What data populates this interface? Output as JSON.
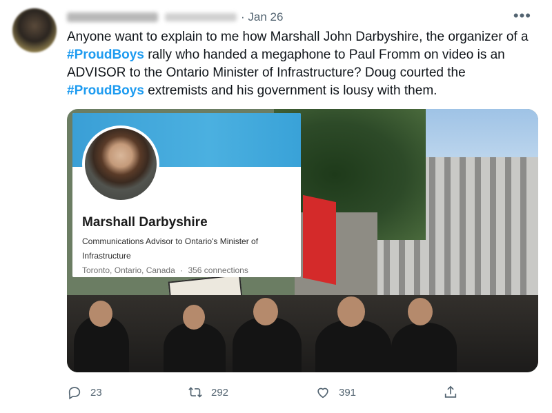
{
  "tweet": {
    "date": "Jan 26",
    "more_label": "•••",
    "text_parts": [
      "Anyone want to explain to me how Marshall John Darbyshire, the organizer of a ",
      "#ProudBoys",
      " rally who handed a megaphone to Paul Fromm on video is an ADVISOR to the Ontario Minister of Infrastructure? Doug courted the ",
      "#ProudBoys",
      " extremists and his government is lousy with them."
    ]
  },
  "linkedin_card": {
    "name": "Marshall Darbyshire",
    "title": "Communications Advisor to Ontario's Minister of Infrastructure",
    "location": "Toronto, Ontario, Canada",
    "separator": "·",
    "connections": "356 connections"
  },
  "actions": {
    "reply_count": "23",
    "retweet_count": "292",
    "like_count": "391",
    "icons": [
      "reply-icon",
      "retweet-icon",
      "like-icon",
      "share-icon"
    ]
  },
  "colors": {
    "hashtag": "#1d9bf0",
    "meta_gray": "#536471",
    "linkedin_banner": "#3a9fd6"
  }
}
